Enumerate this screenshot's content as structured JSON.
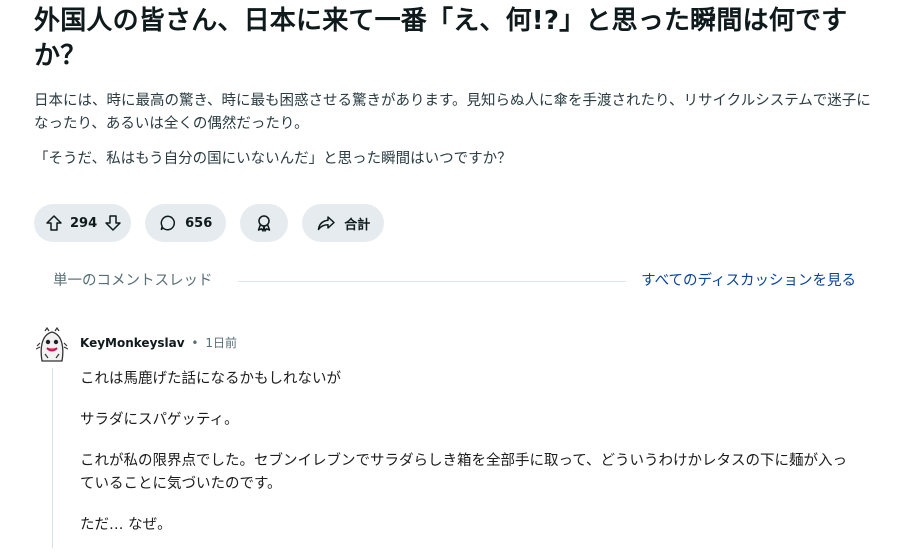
{
  "post": {
    "title": "外国人の皆さん、日本に来て一番「え、何!?」と思った瞬間は何ですか？",
    "body": [
      "日本には、時に最高の驚き、時に最も困惑させる驚きがあります。見知らぬ人に傘を手渡されたり、リサイクルシステムで迷子になったり、あるいは全くの偶然だったり。",
      "「そうだ、私はもう自分の国にいないんだ」と思った瞬間はいつですか？"
    ],
    "actions": {
      "upvotes": "294",
      "comments": "656",
      "share_label": "合計"
    }
  },
  "thread": {
    "label": "単一のコメントスレッド",
    "see_all": "すべてのディスカッションを見る"
  },
  "comment": {
    "author": "KeyMonkeyslav",
    "separator": "•",
    "time": "1日前",
    "paragraphs": [
      "これは馬鹿げた話になるかもしれないが",
      "サラダにスパゲッティ。",
      "これが私の限界点でした。セブンイレブンでサラダらしき箱を全部手に取って、どういうわけかレタスの下に麺が入っていることに気づいたのです。",
      "ただ… なぜ。"
    ]
  },
  "colors": {
    "pill_bg": "#e5ebee",
    "link": "#0a449b",
    "muted": "#576f76"
  }
}
